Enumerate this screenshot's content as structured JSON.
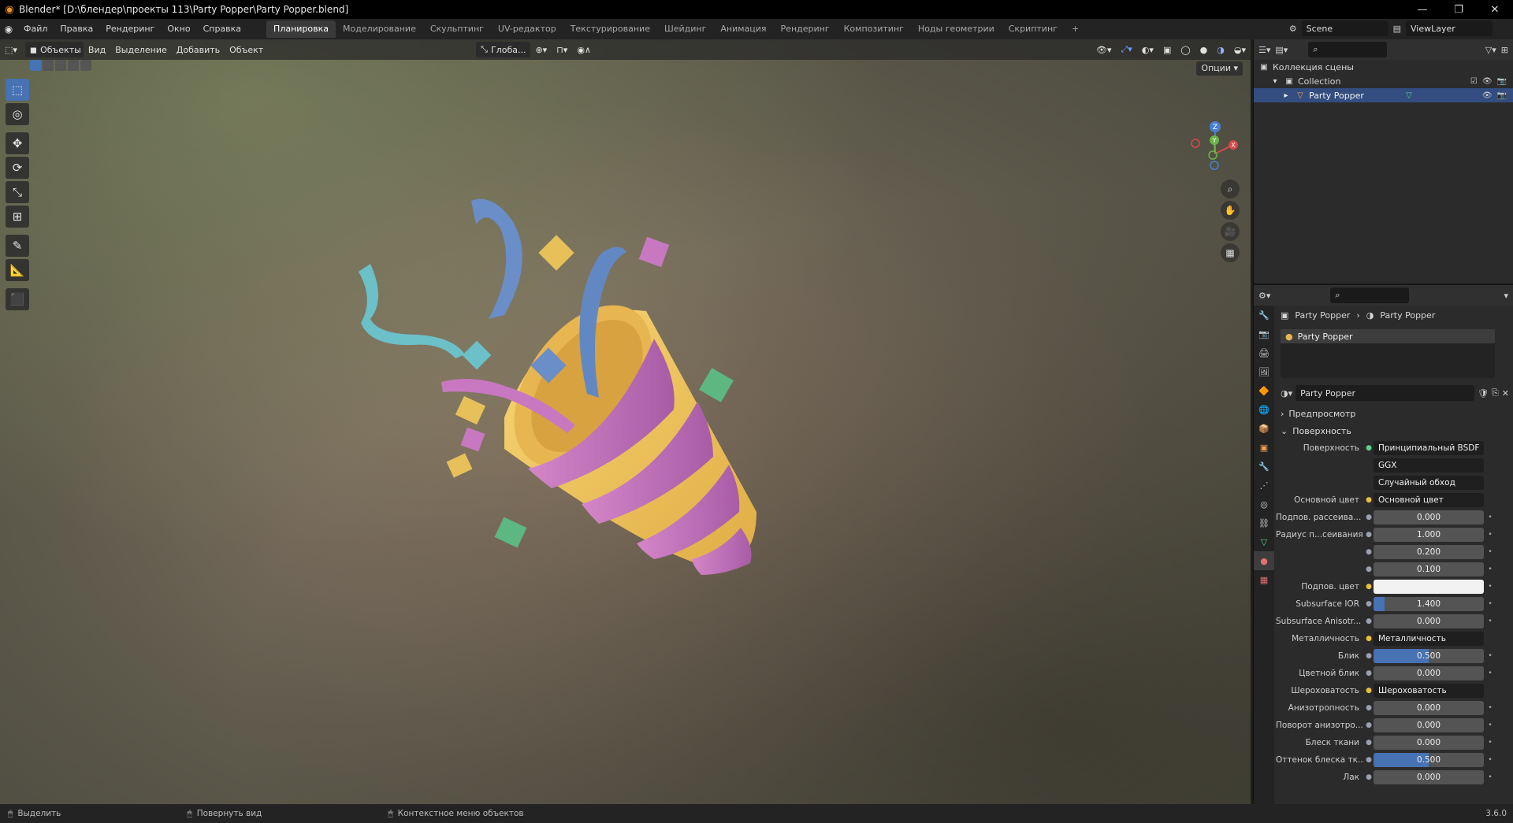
{
  "window": {
    "title": "Blender* [D:\\блендер\\проекты 113\\Party Popper\\Party Popper.blend]",
    "controls": [
      "—",
      "❐",
      "✕"
    ]
  },
  "menu": [
    "Файл",
    "Правка",
    "Рендеринг",
    "Окно",
    "Справка"
  ],
  "workspaces": [
    {
      "label": "Планировка",
      "active": true
    },
    {
      "label": "Моделирование"
    },
    {
      "label": "Скульптинг"
    },
    {
      "label": "UV-редактор"
    },
    {
      "label": "Текстурирование"
    },
    {
      "label": "Шейдинг"
    },
    {
      "label": "Анимация"
    },
    {
      "label": "Рендеринг"
    },
    {
      "label": "Композитинг"
    },
    {
      "label": "Ноды геометрии"
    },
    {
      "label": "Скриптинг"
    },
    {
      "label": "+"
    }
  ],
  "scene": {
    "name": "Scene",
    "view_layer": "ViewLayer"
  },
  "viewport": {
    "mode": "Объекты",
    "menus": [
      "Вид",
      "Выделение",
      "Добавить",
      "Объект"
    ],
    "transform_orientation": "Глоба...",
    "options": "Опции",
    "gizmo_axes": [
      "Z",
      "Y",
      "X"
    ]
  },
  "toolbar": [
    "select-box",
    "cursor",
    "move",
    "rotate",
    "scale",
    "transform",
    "annotate",
    "measure",
    "add-cube"
  ],
  "outliner": {
    "root": "Коллекция сцены",
    "collection": "Collection",
    "object": "Party Popper"
  },
  "properties": {
    "breadcrumb": [
      "Party Popper",
      "Party Popper"
    ],
    "slot": "Party Popper",
    "material": "Party Popper",
    "sections": {
      "preview": "Предпросмотр",
      "surface": "Поверхность"
    },
    "surface_label": "Поверхность",
    "surface_value": "Принципиальный BSDF",
    "distribution": "GGX",
    "subsurface_method": "Случайный обход",
    "rows": [
      {
        "label": "Основной цвет",
        "value": "Основной цвет",
        "type": "link"
      },
      {
        "label": "Подпов. рассеива...",
        "value": "0.000",
        "type": "num"
      },
      {
        "label": "Радиус п...сеивания",
        "value": "1.000",
        "type": "num"
      },
      {
        "label": "",
        "value": "0.200",
        "type": "num"
      },
      {
        "label": "",
        "value": "0.100",
        "type": "num"
      },
      {
        "label": "Подпов. цвет",
        "value": "",
        "type": "color",
        "color": "#f2f2f2"
      },
      {
        "label": "Subsurface IOR",
        "value": "1.400",
        "type": "num",
        "fill": 0.1
      },
      {
        "label": "Subsurface Anisotr...",
        "value": "0.000",
        "type": "num"
      },
      {
        "label": "Металличность",
        "value": "Металличность",
        "type": "link"
      },
      {
        "label": "Блик",
        "value": "0.500",
        "type": "num",
        "fill": 0.5
      },
      {
        "label": "Цветной блик",
        "value": "0.000",
        "type": "num"
      },
      {
        "label": "Шероховатость",
        "value": "Шероховатость",
        "type": "link"
      },
      {
        "label": "Анизотропность",
        "value": "0.000",
        "type": "num"
      },
      {
        "label": "Поворот анизотро...",
        "value": "0.000",
        "type": "num"
      },
      {
        "label": "Блеск ткани",
        "value": "0.000",
        "type": "num"
      },
      {
        "label": "Оттенок блеска тк...",
        "value": "0.500",
        "type": "num",
        "fill": 0.5
      },
      {
        "label": "Лак",
        "value": "0.000",
        "type": "num"
      }
    ]
  },
  "statusbar": {
    "items": [
      "Выделить",
      "Повернуть вид",
      "Контекстное меню объектов"
    ],
    "version": "3.6.0"
  },
  "colors": {
    "accent": "#4772b3",
    "cone_yellow": "#f0c860",
    "stripe_pink": "#c878c0",
    "ribbon_blue": "#6a8ec8",
    "ribbon_teal": "#6cc0c8",
    "confetti_green": "#5cb880"
  }
}
